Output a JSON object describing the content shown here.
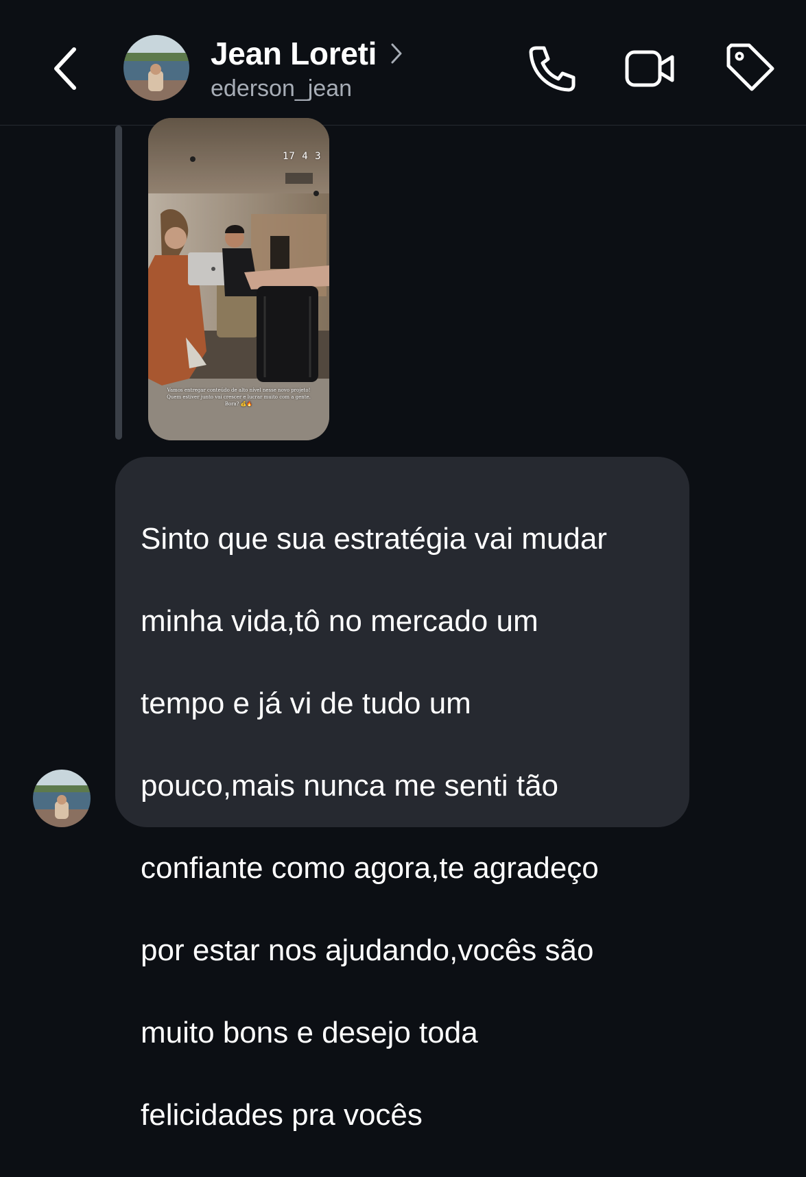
{
  "header": {
    "back_icon": "chevron-left-icon",
    "contact_name": "Jean Loreti",
    "username": "ederson_jean",
    "name_chevron_icon": "chevron-right-icon",
    "actions": [
      {
        "icon": "phone-icon"
      },
      {
        "icon": "video-camera-icon"
      },
      {
        "icon": "tag-icon"
      }
    ]
  },
  "story": {
    "time": "17 4 3",
    "caption_lines": [
      "Vamos entregar conteúdo de alto nível nesse novo projeto!",
      "Quem estiver junto vai crescer e lucrar muito com a gente.",
      "Bora? 💰🔥"
    ]
  },
  "message": {
    "lines": [
      "Sinto que sua estratégia vai mudar",
      "minha vida,tô no mercado um",
      "tempo e já vi de tudo um",
      "pouco,mais nunca me senti tão",
      "confiante como agora,te agradeço",
      "por estar nos ajudando,vocês são",
      "muito bons e desejo toda",
      "felicidades pra vocês"
    ]
  },
  "colors": {
    "background": "#0c0f14",
    "bubble": "#262930",
    "secondary_text": "#a7adb6",
    "quote_bar": "#3a3f47"
  }
}
